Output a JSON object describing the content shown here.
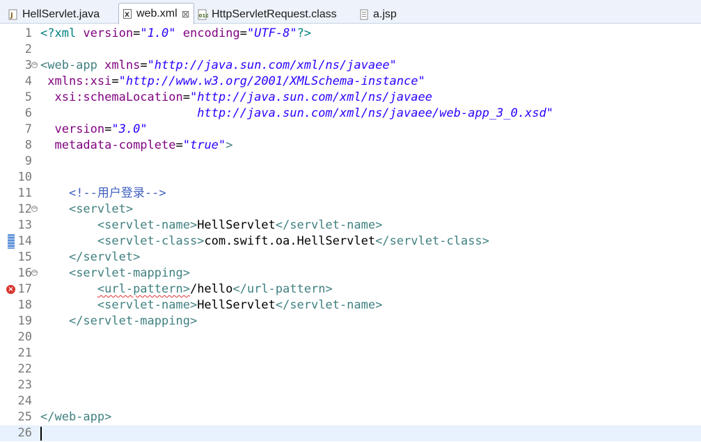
{
  "tabs": [
    {
      "label": "HellServlet.java",
      "icon": "java-file-icon",
      "active": false
    },
    {
      "label": "web.xml",
      "icon": "xml-file-icon",
      "active": true,
      "close": "⊠"
    },
    {
      "label": "HttpServletRequest.class",
      "icon": "class-file-icon",
      "active": false
    },
    {
      "label": "a.jsp",
      "icon": "jsp-file-icon",
      "active": false
    }
  ],
  "editor": {
    "lines": [
      {
        "n": "1",
        "code": [
          {
            "t": "pi",
            "v": "<?xml "
          },
          {
            "t": "attr",
            "v": "version"
          },
          {
            "t": "text",
            "v": "="
          },
          {
            "t": "str",
            "v": "\"1.0\""
          },
          {
            "t": "text",
            "v": " "
          },
          {
            "t": "attr",
            "v": "encoding"
          },
          {
            "t": "text",
            "v": "="
          },
          {
            "t": "str",
            "v": "\"UTF-8\""
          },
          {
            "t": "pi",
            "v": "?>"
          }
        ]
      },
      {
        "n": "2",
        "code": []
      },
      {
        "n": "3",
        "fold": "⊖",
        "code": [
          {
            "t": "tag",
            "v": "<web-app "
          },
          {
            "t": "attr",
            "v": "xmlns"
          },
          {
            "t": "text",
            "v": "="
          },
          {
            "t": "str",
            "v": "\"http://java.sun.com/xml/ns/javaee\""
          }
        ]
      },
      {
        "n": "4",
        "code": [
          {
            "t": "text",
            "v": " "
          },
          {
            "t": "attr",
            "v": "xmlns:xsi"
          },
          {
            "t": "text",
            "v": "="
          },
          {
            "t": "str",
            "v": "\"http://www.w3.org/2001/XMLSchema-instance\""
          }
        ]
      },
      {
        "n": "5",
        "code": [
          {
            "t": "text",
            "v": "  "
          },
          {
            "t": "attr",
            "v": "xsi:schemaLocation"
          },
          {
            "t": "text",
            "v": "="
          },
          {
            "t": "str",
            "v": "\"http://java.sun.com/xml/ns/javaee"
          }
        ]
      },
      {
        "n": "6",
        "code": [
          {
            "t": "text",
            "v": "                      "
          },
          {
            "t": "str",
            "v": "http://java.sun.com/xml/ns/javaee/web-app_3_0.xsd\""
          }
        ]
      },
      {
        "n": "7",
        "code": [
          {
            "t": "text",
            "v": "  "
          },
          {
            "t": "attr",
            "v": "version"
          },
          {
            "t": "text",
            "v": "="
          },
          {
            "t": "str",
            "v": "\"3.0\""
          }
        ]
      },
      {
        "n": "8",
        "code": [
          {
            "t": "text",
            "v": "  "
          },
          {
            "t": "attr",
            "v": "metadata-complete"
          },
          {
            "t": "text",
            "v": "="
          },
          {
            "t": "str",
            "v": "\"true\""
          },
          {
            "t": "tag",
            "v": ">"
          }
        ]
      },
      {
        "n": "9",
        "code": []
      },
      {
        "n": "10",
        "code": []
      },
      {
        "n": "11",
        "code": [
          {
            "t": "text",
            "v": "    "
          },
          {
            "t": "cmt",
            "v": "<!--用户登录-->"
          }
        ]
      },
      {
        "n": "12",
        "fold": "⊖",
        "code": [
          {
            "t": "text",
            "v": "    "
          },
          {
            "t": "tag",
            "v": "<servlet>"
          }
        ]
      },
      {
        "n": "13",
        "code": [
          {
            "t": "text",
            "v": "        "
          },
          {
            "t": "tag",
            "v": "<servlet-name>"
          },
          {
            "t": "text",
            "v": "HellServlet"
          },
          {
            "t": "tag",
            "v": "</servlet-name>"
          }
        ]
      },
      {
        "n": "14",
        "marker": "change",
        "code": [
          {
            "t": "text",
            "v": "        "
          },
          {
            "t": "tag",
            "v": "<servlet-class>"
          },
          {
            "t": "text",
            "v": "com.swift.oa.HellServlet"
          },
          {
            "t": "tag",
            "v": "</servlet-class>"
          }
        ]
      },
      {
        "n": "15",
        "code": [
          {
            "t": "text",
            "v": "    "
          },
          {
            "t": "tag",
            "v": "</servlet>"
          }
        ]
      },
      {
        "n": "16",
        "fold": "⊖",
        "code": [
          {
            "t": "text",
            "v": "    "
          },
          {
            "t": "tag",
            "v": "<servlet-mapping>"
          }
        ]
      },
      {
        "n": "17",
        "marker": "error",
        "code": [
          {
            "t": "text",
            "v": "        "
          },
          {
            "t": "tag err",
            "v": "<url-pattern>"
          },
          {
            "t": "text",
            "v": "/hello"
          },
          {
            "t": "tag",
            "v": "</url-pattern>"
          }
        ]
      },
      {
        "n": "18",
        "code": [
          {
            "t": "text",
            "v": "        "
          },
          {
            "t": "tag",
            "v": "<servlet-name>"
          },
          {
            "t": "text",
            "v": "HellServlet"
          },
          {
            "t": "tag",
            "v": "</servlet-name>"
          }
        ]
      },
      {
        "n": "19",
        "code": [
          {
            "t": "text",
            "v": "    "
          },
          {
            "t": "tag",
            "v": "</servlet-mapping>"
          }
        ]
      },
      {
        "n": "20",
        "code": []
      },
      {
        "n": "21",
        "code": []
      },
      {
        "n": "22",
        "code": []
      },
      {
        "n": "23",
        "code": []
      },
      {
        "n": "24",
        "code": []
      },
      {
        "n": "25",
        "code": [
          {
            "t": "tag",
            "v": "</web-app>"
          }
        ]
      },
      {
        "n": "26",
        "current": true,
        "code": []
      }
    ]
  },
  "colors": {
    "tag": "#3f7f7f",
    "attr": "#7f007f",
    "string": "#2a00ff",
    "comment": "#3f5fbf",
    "current_line": "#e8f2fe",
    "error": "#d9362f"
  }
}
